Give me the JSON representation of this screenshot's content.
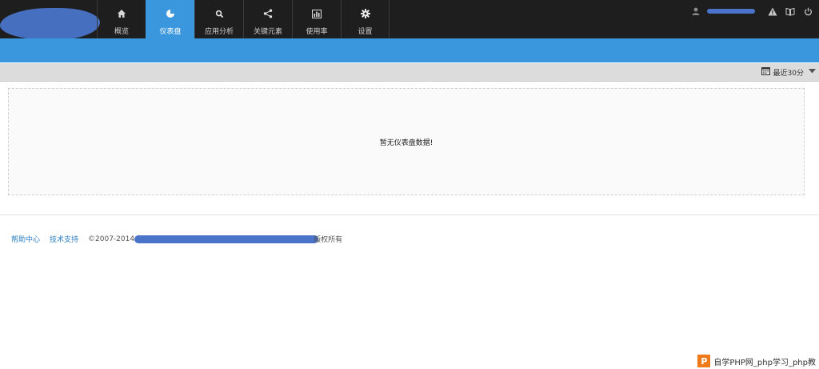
{
  "nav": {
    "items": [
      {
        "label": "概览",
        "icon": "home-icon"
      },
      {
        "label": "仪表盘",
        "icon": "pie-chart-icon",
        "active": true
      },
      {
        "label": "应用分析",
        "icon": "search-icon"
      },
      {
        "label": "关键元素",
        "icon": "share-icon"
      },
      {
        "label": "使用率",
        "icon": "bar-chart-icon"
      },
      {
        "label": "设置",
        "icon": "gear-icon"
      }
    ]
  },
  "toolbar": {
    "range_label": "最近30分"
  },
  "dashboard": {
    "empty_message": "暂无仪表盘数据!"
  },
  "footer": {
    "help_link": "帮助中心",
    "support_link": "技术支持",
    "copyright_prefix": "©2007-2014",
    "copyright_suffix": "版权所有"
  },
  "watermark": {
    "logo_letter": "P",
    "text": "自学PHP网_php学习_php教"
  },
  "colors": {
    "topbar": "#1e1e1e",
    "accent": "#3a96dd",
    "toolbar": "#dcdcdc",
    "link": "#2a7ec3"
  }
}
